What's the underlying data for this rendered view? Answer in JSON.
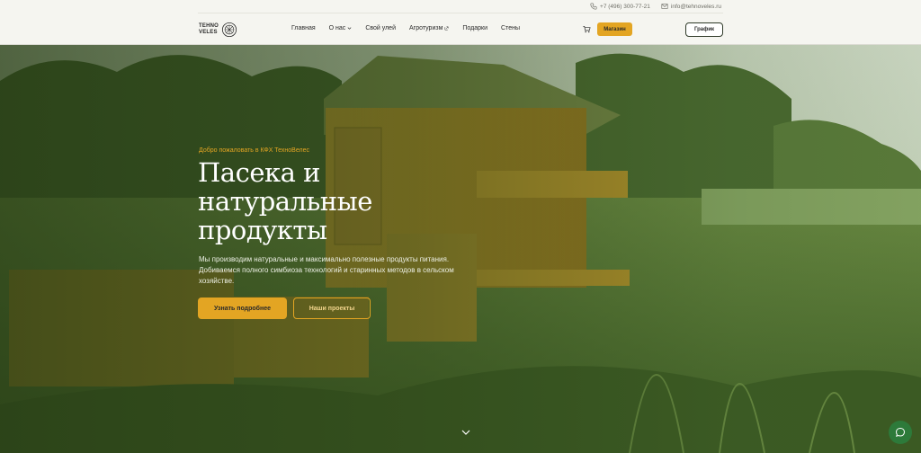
{
  "header": {
    "phone": "+7 (496) 300-77-21",
    "email": "info@tehnoveles.ru",
    "logo": {
      "line1": "TEHNO",
      "line2": "VELES"
    },
    "nav": [
      {
        "label": "Главная"
      },
      {
        "label": "О нас",
        "icon": "chevron-down-icon"
      },
      {
        "label": "Свой улей"
      },
      {
        "label": "Агротуризм",
        "icon": "external-link-icon"
      },
      {
        "label": "Подарки"
      },
      {
        "label": "Стены"
      }
    ],
    "cart_icon": "cart-icon",
    "shop_button": "Магазин",
    "schedule_button": "График"
  },
  "hero": {
    "welcome": "Добро пожаловать в КФХ ТехноВелес",
    "title": "Пасека и натуральные продукты",
    "description": "Мы производим натуральные и максимально полезные продукты питания. Добиваемся полного симбиоза технологий и старинных методов в сельском хозяйстве.",
    "primary_button": "Узнать подробнее",
    "secondary_button": "Наши проекты",
    "scroll_icon": "chevron-down-icon",
    "chat_icon": "chat-icon"
  },
  "colors": {
    "accent": "#e3a523",
    "header_bg": "#f5f5f0",
    "chat": "#2d7a3a"
  }
}
